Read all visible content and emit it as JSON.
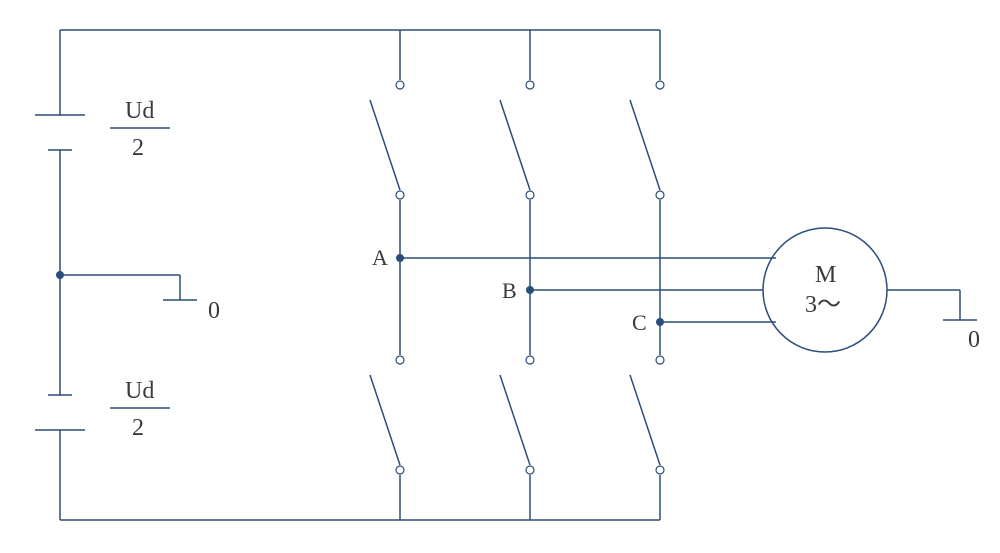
{
  "labels": {
    "cap_top_num": "Ud",
    "cap_top_den": "2",
    "cap_bot_num": "Ud",
    "cap_bot_den": "2",
    "gnd_left": "0",
    "gnd_right": "0",
    "phase_a": "A",
    "phase_b": "B",
    "phase_c": "C",
    "motor_m": "M",
    "motor_phase": "3～"
  },
  "chart_data": {
    "type": "diagram",
    "description": "Three-phase voltage-source inverter feeding a three-phase AC motor",
    "dc_link": {
      "total_voltage_symbol": "Ud",
      "split_capacitors": [
        {
          "value_symbol": "Ud/2",
          "position": "top"
        },
        {
          "value_symbol": "Ud/2",
          "position": "bottom"
        }
      ],
      "midpoint_ground_label": "0"
    },
    "inverter": {
      "legs": 3,
      "switches_per_leg": 2,
      "total_switches": 6,
      "output_nodes": [
        "A",
        "B",
        "C"
      ]
    },
    "load": {
      "type": "motor",
      "label": "M",
      "designation": "3~",
      "phases": 3,
      "neutral_ground_label": "0"
    }
  }
}
